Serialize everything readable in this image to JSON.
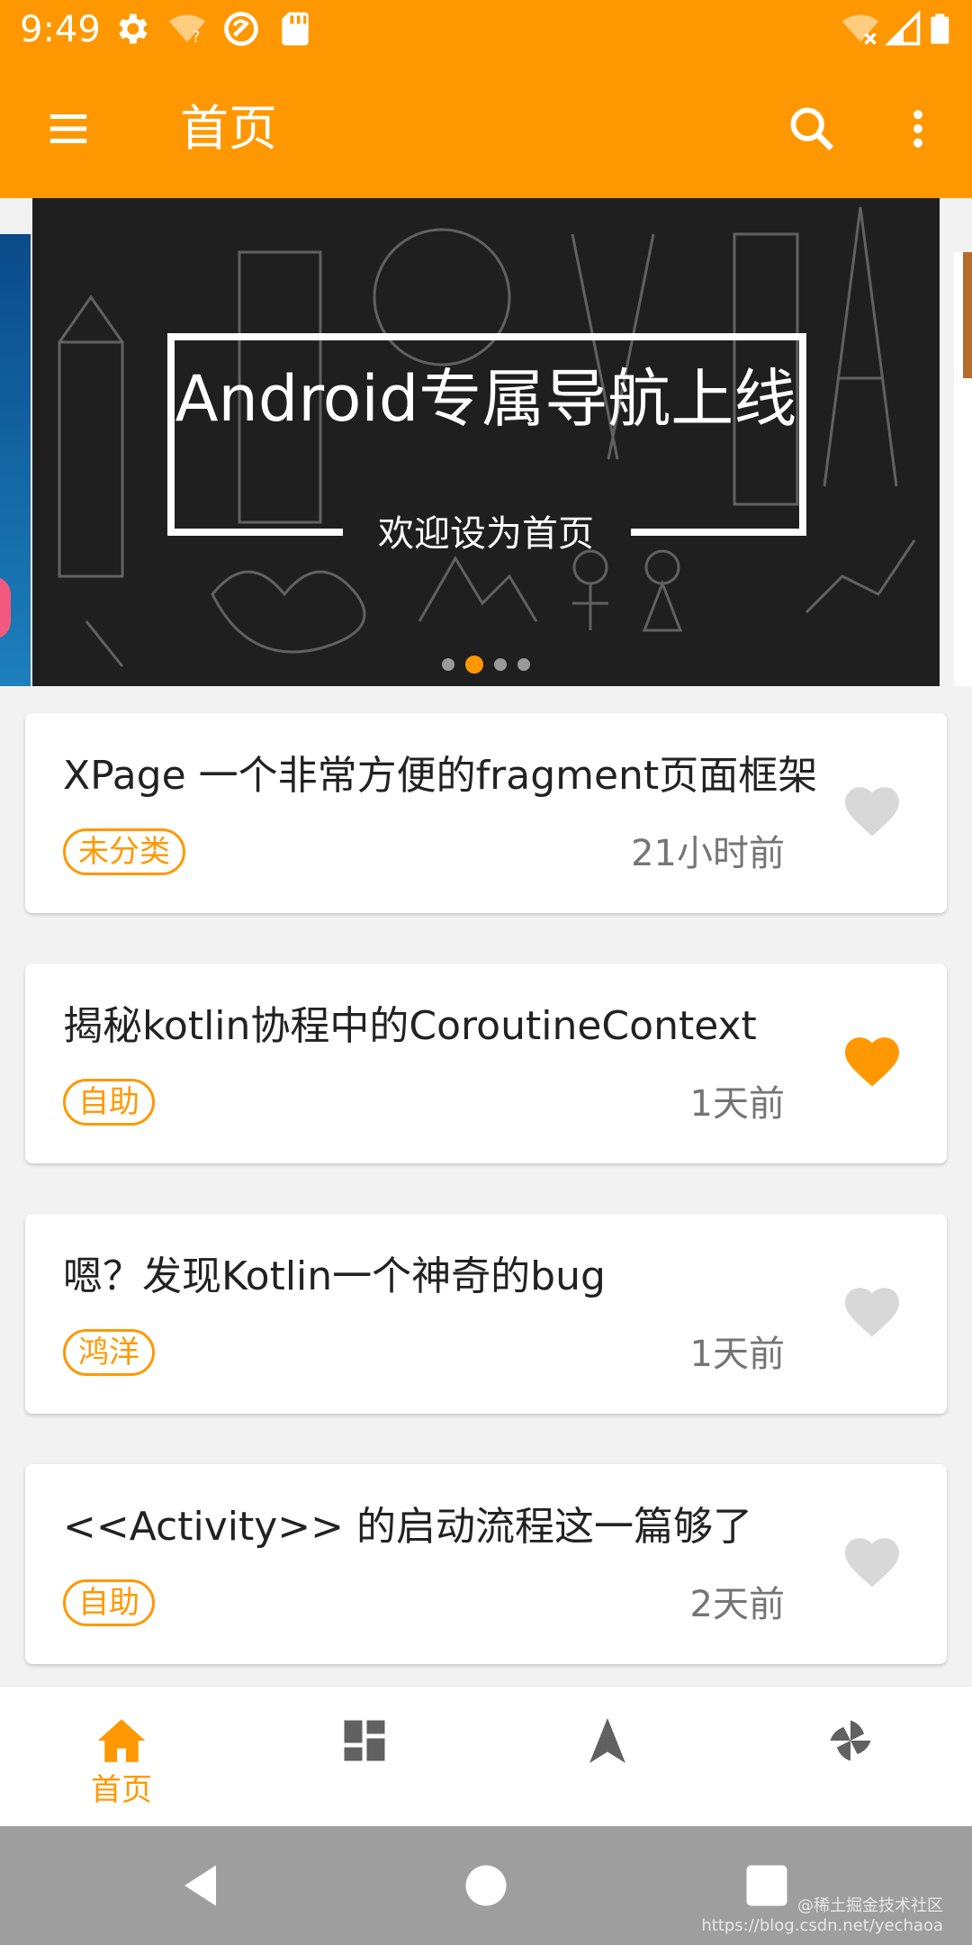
{
  "status_bar": {
    "time": "9:49",
    "left_icons": [
      "gear-icon",
      "wifi-question-icon",
      "sync-icon",
      "sd-card-icon"
    ],
    "right_icons": [
      "wifi-off-icon",
      "signal-icon",
      "battery-icon"
    ]
  },
  "toolbar": {
    "title": "首页",
    "menu_icon": "menu-icon",
    "search_icon": "search-icon",
    "more_icon": "more-vert-icon"
  },
  "banner": {
    "title": "Android专属导航上线",
    "subtitle": "欢迎设为首页",
    "page_count": 4,
    "active_page": 2
  },
  "articles": [
    {
      "title": "XPage 一个非常方便的fragment页面框架",
      "tag": "未分类",
      "time": "21小时前",
      "liked": false
    },
    {
      "title": "揭秘kotlin协程中的CoroutineContext",
      "tag": "自助",
      "time": "1天前",
      "liked": true
    },
    {
      "title": "嗯？发现Kotlin一个神奇的bug",
      "tag": "鸿洋",
      "time": "1天前",
      "liked": false
    },
    {
      "title": "<<Activity>> 的启动流程这一篇够了",
      "tag": "自助",
      "time": "2天前",
      "liked": false
    }
  ],
  "bottom_nav": {
    "items": [
      {
        "label": "首页",
        "icon": "home-icon",
        "selected": true
      },
      {
        "label": "",
        "icon": "dashboard-icon",
        "selected": false
      },
      {
        "label": "",
        "icon": "navigation-icon",
        "selected": false
      },
      {
        "label": "",
        "icon": "pinwheel-icon",
        "selected": false
      }
    ]
  },
  "watermark": {
    "line1": "@稀土掘金技术社区",
    "line2": "https://blog.csdn.net/yechaoa"
  },
  "colors": {
    "accent": "#ff9800",
    "liked_heart": "#ff9800",
    "unliked_heart": "#d8d8d8",
    "nav_inactive": "#616161",
    "system_nav": "#9e9e9e"
  }
}
